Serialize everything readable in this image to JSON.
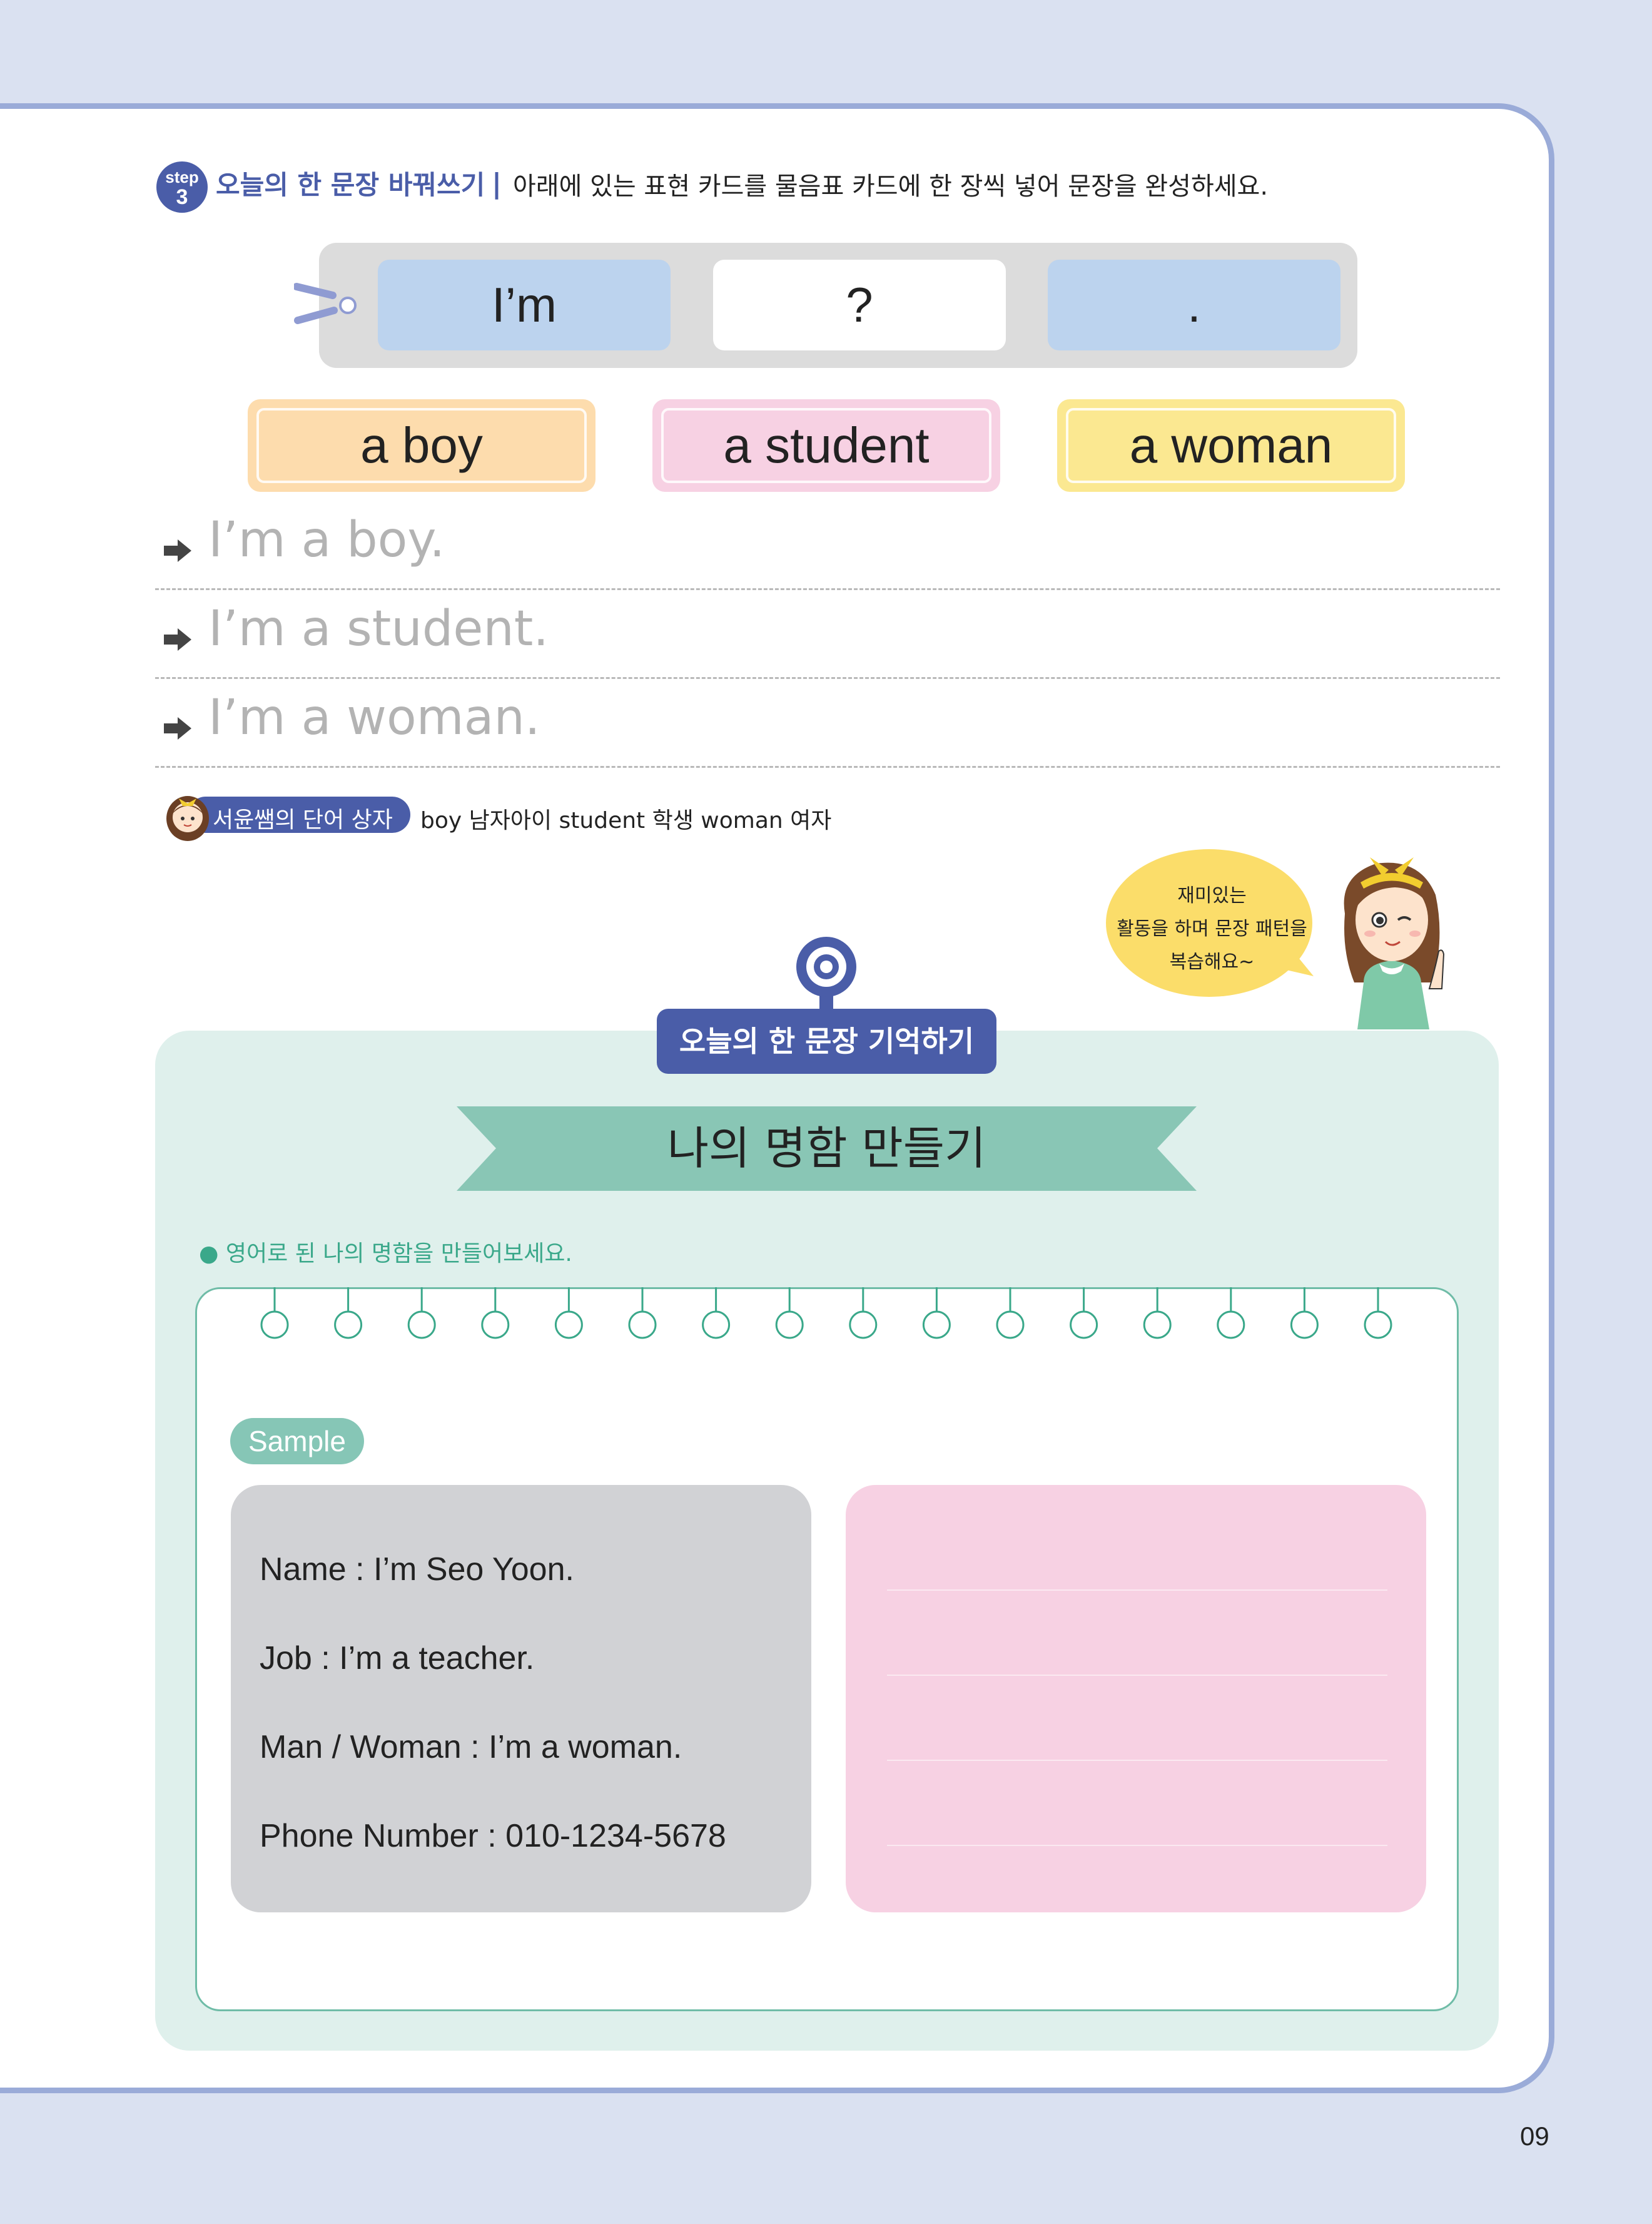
{
  "step": {
    "badge_top": "step",
    "badge_num": "3",
    "title": "오늘의 한 문장 바꿔쓰기",
    "separator": "|",
    "instruction": "아래에 있는 표현 카드를 물음표 카드에 한 장씩 넣어 문장을 완성하세요."
  },
  "sentence_strip": {
    "start": "I’m",
    "blank": "?",
    "end": "."
  },
  "expression_cards": [
    "a boy",
    "a student",
    "a woman"
  ],
  "answers": [
    "I’m a boy.",
    "I’m a student.",
    "I’m a woman."
  ],
  "word_box": {
    "label": "서윤쌤의 단어 상자",
    "words": "boy 남자아이  student 학생  woman 여자"
  },
  "speech_bubble": {
    "line1": "재미있는",
    "line2": "활동을 하며 문장 패턴을",
    "line3": "복습해요~"
  },
  "memory_section": {
    "tag": "오늘의 한 문장 기억하기",
    "ribbon_title": "나의 명함 만들기",
    "instruction": "영어로 된 나의 명함을 만들어보세요."
  },
  "sample": {
    "label": "Sample",
    "lines": [
      "Name : I’m Seo Yoon.",
      "Job : I’m a teacher.",
      "Man / Woman : I’m a woman.",
      "Phone Number : 010-1234-5678"
    ]
  },
  "page_number": "09",
  "colors": {
    "background": "#dae1f1",
    "accent_navy": "#4a5da8",
    "card_orange": "#fddcad",
    "card_pink": "#f7d1e3",
    "card_yellow": "#fbe891",
    "panel_mint": "#dff0ec",
    "ribbon_green": "#89c6b5"
  }
}
